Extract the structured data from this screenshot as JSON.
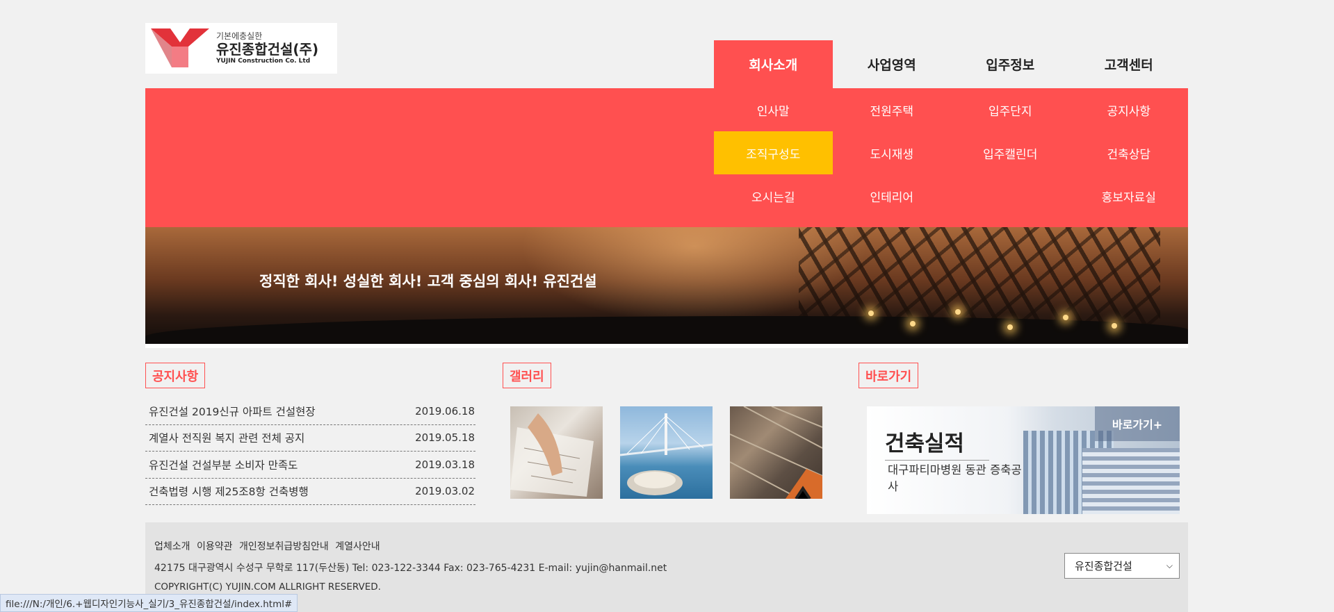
{
  "header": {
    "logo": {
      "slogan": "기본에충실한",
      "name": "유진종합건설(주)",
      "english": "YUJIN Construction Co. Ltd"
    },
    "nav": [
      {
        "label": "회사소개",
        "active": true
      },
      {
        "label": "사업영역",
        "active": false
      },
      {
        "label": "입주정보",
        "active": false
      },
      {
        "label": "고객센터",
        "active": false
      }
    ],
    "dropdown": {
      "col0": [
        "인사말",
        "조직구성도",
        "오시는길"
      ],
      "col1": [
        "전원주택",
        "도시재생",
        "인테리어"
      ],
      "col2": [
        "입주단지",
        "입주캘린더"
      ],
      "col3": [
        "공지사항",
        "건축상담",
        "홍보자료실"
      ],
      "highlighted": "조직구성도"
    },
    "colors": {
      "accent": "#ff5050",
      "highlight": "#ffc000"
    }
  },
  "banner": {
    "subtitle": "정직한 회사! 성실한 회사! 고객 중심의 회사! 유진건설"
  },
  "notice": {
    "title": "공지사항",
    "items": [
      {
        "text": "유진건설 2019신규 아파트 건설현장",
        "date": "2019.06.18"
      },
      {
        "text": "계열사 전직원 복지 관련 전체 공지",
        "date": "2019.05.18"
      },
      {
        "text": "유진건설 건설부분 소비자 만족도",
        "date": "2019.03.18"
      },
      {
        "text": "건축법령 시행 제25조8항 건축병행",
        "date": "2019.03.02"
      }
    ]
  },
  "gallery": {
    "title": "갤러리"
  },
  "shortcut": {
    "title": "바로가기",
    "banner_title": "건축실적",
    "banner_desc": "대구파티마병원 동관 증축공사",
    "more": "바로가기+"
  },
  "footer": {
    "links": [
      "업체소개",
      "이용약관",
      "개인정보취급방침안내",
      "계열사안내"
    ],
    "address": "42175 대구광역시 수성구 무학로 117(두산동) Tel: 023-122-3344 Fax: 023-765-4231 E-mail: yujin@hanmail.net",
    "copyright": "COPYRIGHT(C) YUJIN.COM ALLRIGHT RESERVED.",
    "select_value": "유진종합건설"
  },
  "statusbar": {
    "url": "file:///N:/개인/6.+웹디자인기능사_실기/3_유진종합건설/index.html#"
  }
}
